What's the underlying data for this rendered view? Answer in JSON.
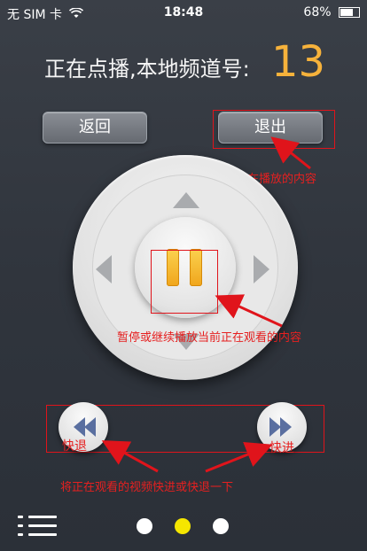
{
  "status_bar": {
    "carrier": "无 SIM 卡",
    "time": "18:48",
    "battery": "68%",
    "battery_level": 0.68
  },
  "header": {
    "label": "正在点播,本地频道号:",
    "channel_number": "13"
  },
  "buttons": {
    "back": "返回",
    "exit": "退出"
  },
  "annotations": {
    "exit_note": "退出当前正在播放的内容",
    "pause_note": "暂停或继续播放当前正在观看的内容",
    "rewind_label": "快退",
    "forward_label": "快进",
    "seek_note": "将正在观看的视频快进或快退一下"
  },
  "pagination": {
    "count": 3,
    "active_index": 1
  },
  "colors": {
    "accent": "#f6b23b",
    "annotation": "#e62020",
    "active_dot": "#f5e600",
    "inactive_dot": "#ffffff"
  },
  "icons": [
    "wifi-icon",
    "battery-icon",
    "up-arrow-icon",
    "down-arrow-icon",
    "left-arrow-icon",
    "right-arrow-icon",
    "pause-icon",
    "rewind-icon",
    "fast-forward-icon",
    "menu-list-icon"
  ]
}
